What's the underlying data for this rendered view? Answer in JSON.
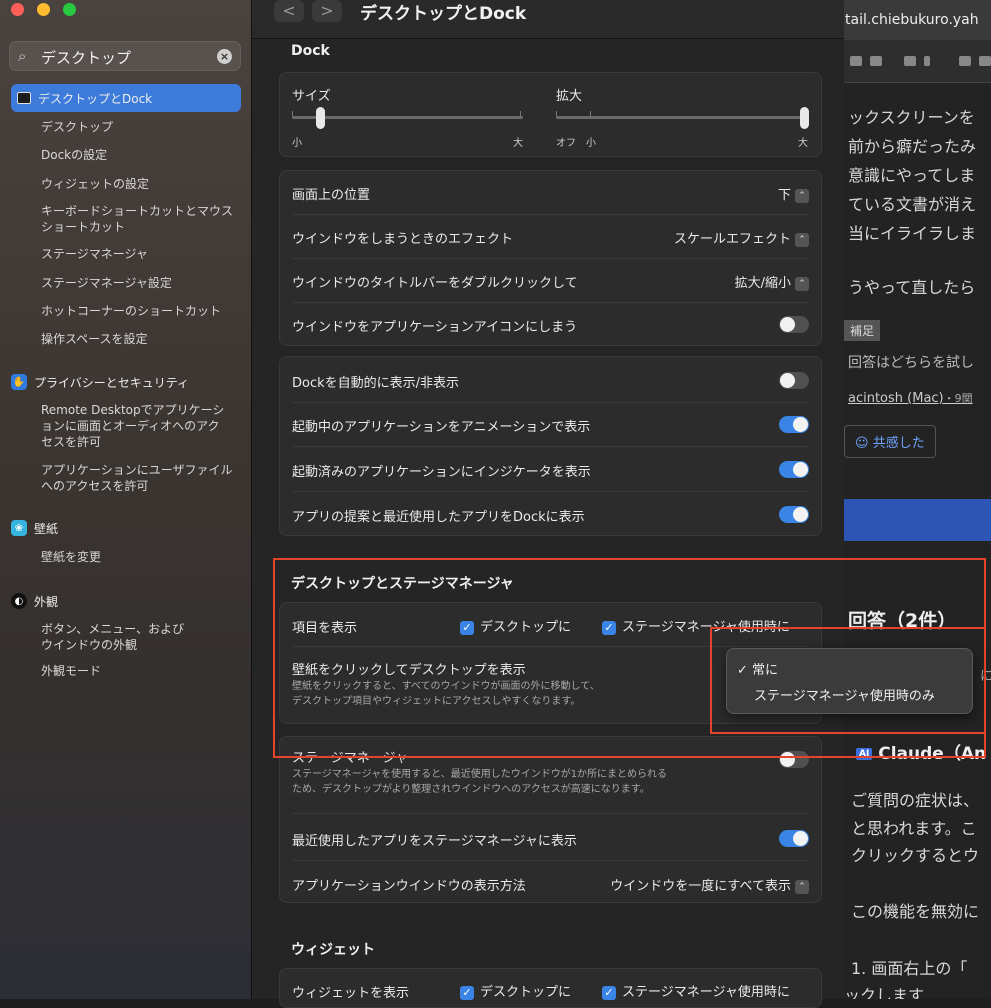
{
  "sidebar": {
    "search_value": "デスクトップ",
    "selected": "デスクトップとDock",
    "sub1": [
      "デスクトップ",
      "Dockの設定",
      "ウィジェットの設定",
      "キーボードショートカットとマウスショートカット",
      "ステージマネージャ",
      "ステージマネージャ設定",
      "ホットコーナーのショートカット",
      "操作スペースを設定"
    ],
    "privacy": "プライバシーとセキュリティ",
    "privacy_subs": [
      "Remote Desktopでアプリケーションに画面とオーディオへのアクセスを許可",
      "アプリケーションにユーザファイルへのアクセスを許可"
    ],
    "wallpaper": "壁紙",
    "wallpaper_sub": "壁紙を変更",
    "appearance": "外観",
    "appearance_subs": [
      "ボタン、メニュー、およびウインドウの外観",
      "外観モード"
    ]
  },
  "header": {
    "back": "<",
    "forward": ">",
    "title": "デスクトップとDock"
  },
  "dock": {
    "section": "Dock",
    "size_label": "サイズ",
    "size_min": "小",
    "size_max": "大",
    "size_value": 0.12,
    "mag_label": "拡大",
    "mag_off": "オフ",
    "mag_min": "小",
    "mag_max": "大",
    "mag_value": 1.0,
    "position_label": "画面上の位置",
    "position_value": "下",
    "minimize_label": "ウインドウをしまうときのエフェクト",
    "minimize_value": "スケールエフェクト",
    "dblclick_label": "ウインドウのタイトルバーをダブルクリックして",
    "dblclick_value": "拡大/縮小",
    "minimize_icon_label": "ウインドウをアプリケーションアイコンにしまう",
    "autohide_label": "Dockを自動的に表示/非表示",
    "animate_label": "起動中のアプリケーションをアニメーションで表示",
    "indicator_label": "起動済みのアプリケーションにインジケータを表示",
    "recent_label": "アプリの提案と最近使用したアプリをDockに表示"
  },
  "desktop": {
    "section": "デスクトップとステージマネージャ",
    "show_items_label": "項目を表示",
    "on_desktop": "デスクトップに",
    "in_stage": "ステージマネージャ使用時に",
    "click_wallpaper_label": "壁紙をクリックしてデスクトップを表示",
    "click_wallpaper_desc1": "壁紙をクリックすると、すべてのウインドウが画面の外に移動して、",
    "click_wallpaper_desc2": "デスクトップ項目やウィジェットにアクセスしやすくなります。",
    "stage_label": "ステージマネージャ",
    "stage_desc1": "ステージマネージャを使用すると、最近使用したウインドウが1か所にまとめられる",
    "stage_desc2": "ため、デスクトップがより整理されウインドウへのアクセスが高速になります。",
    "stage_recent_label": "最近使用したアプリをステージマネージャに表示",
    "app_windows_label": "アプリケーションウインドウの表示方法",
    "app_windows_value": "ウインドウを一度にすべて表示"
  },
  "widgets": {
    "section": "ウィジェット",
    "show_label": "ウィジェットを表示",
    "on_desktop": "デスクトップに",
    "in_stage": "ステージマネージャ使用時に"
  },
  "popup": {
    "opt1": "常に",
    "opt2": "ステージマネージャ使用時のみ",
    "check": "✓"
  },
  "browser": {
    "url": "tail.chiebukuro.yah",
    "lines": [
      "ックスクリーンを",
      "前から癖だったみ",
      "意識にやってしま",
      "ている文書が消え",
      "当にイライラしま",
      "うやって直したら"
    ],
    "tag": "補足",
    "q": "回答はどちらを試し",
    "mac": "acintosh (Mac)",
    "mac_meta": "・9関",
    "empathy": "共感した",
    "answers": "回答（2件）",
    "ni": "に",
    "claude": "Claude（An",
    "ai": "AI",
    "body": [
      "ご質問の症状は、",
      "と思われます。こ",
      "クリックするとウ",
      "この機能を無効に",
      "1. 画面右上の「",
      "ックします"
    ]
  },
  "colors": {
    "accent": "#3a84e6",
    "selection": "#3c7bd9",
    "highlight": "#e4442a"
  }
}
